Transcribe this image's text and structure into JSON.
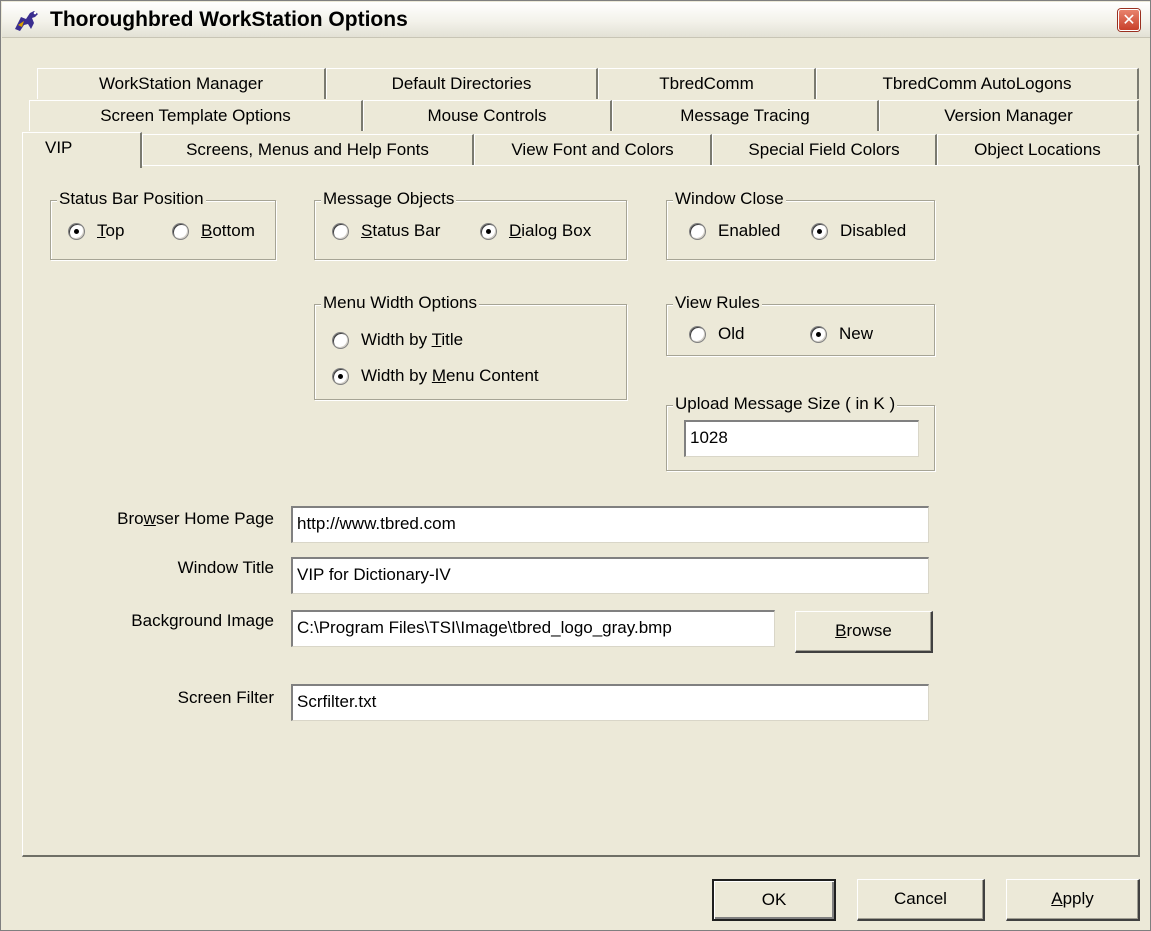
{
  "window": {
    "title": "Thoroughbred WorkStation Options",
    "close_glyph": "✕"
  },
  "tabs": {
    "row1": [
      "WorkStation Manager",
      "Default Directories",
      "TbredComm",
      "TbredComm AutoLogons"
    ],
    "row2": [
      "Screen Template Options",
      "Mouse Controls",
      "Message Tracing",
      "Version Manager"
    ],
    "row3": [
      "VIP",
      "Screens, Menus and Help Fonts",
      "View Font and Colors",
      "Special Field Colors",
      "Object Locations"
    ]
  },
  "status_bar_position": {
    "legend": "Status Bar Position",
    "opt1_pre": "",
    "opt1_ul": "T",
    "opt1_post": "op",
    "opt2_pre": "",
    "opt2_ul": "B",
    "opt2_post": "ottom",
    "selected": "Top"
  },
  "message_objects": {
    "legend": "Message Objects",
    "opt1_pre": "",
    "opt1_ul": "S",
    "opt1_post": "tatus Bar",
    "opt2_pre": "",
    "opt2_ul": "D",
    "opt2_post": "ialog Box",
    "selected": "Dialog Box"
  },
  "window_close": {
    "legend": "Window Close",
    "opt1": "Enabled",
    "opt2": "Disabled",
    "selected": "Disabled"
  },
  "menu_width": {
    "legend": "Menu Width Options",
    "opt1_pre": "Width by ",
    "opt1_ul": "T",
    "opt1_post": "itle",
    "opt2_pre": "Width by ",
    "opt2_ul": "M",
    "opt2_post": "enu Content",
    "selected": "Width by Menu Content"
  },
  "view_rules": {
    "legend": "View Rules",
    "opt1": "Old",
    "opt2": "New",
    "selected": "New"
  },
  "upload": {
    "legend": "Upload Message Size ( in K )",
    "value": "1028"
  },
  "fields": {
    "browser_label_pre": "Bro",
    "browser_label_ul": "w",
    "browser_label_post": "ser Home Page",
    "browser_value": "http://www.tbred.com",
    "window_title_label": "Window Title",
    "window_title_value": "VIP for Dictionary-IV",
    "bg_image_label": "Background Image",
    "bg_image_value": "C:\\Program Files\\TSI\\Image\\tbred_logo_gray.bmp",
    "browse_ul": "B",
    "browse_post": "rowse",
    "screen_filter_label": "Screen Filter",
    "screen_filter_value": "Scrfilter.txt"
  },
  "buttons": {
    "ok": "OK",
    "cancel": "Cancel",
    "apply_ul": "A",
    "apply_post": "pply"
  },
  "icons": {
    "app": "thoroughbred-horse-icon",
    "close": "close-icon"
  }
}
